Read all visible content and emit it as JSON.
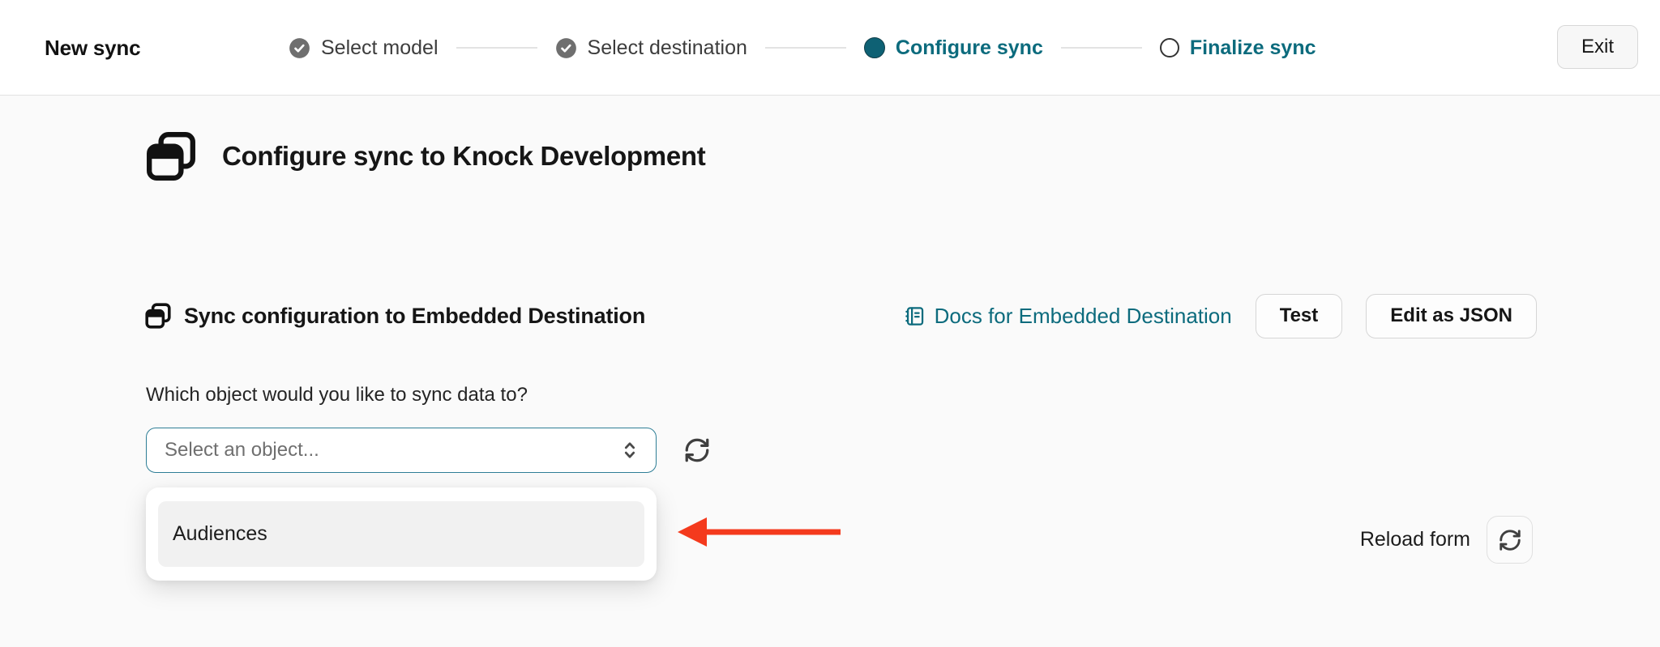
{
  "header": {
    "title": "New sync",
    "steps": [
      {
        "label": "Select model",
        "state": "complete"
      },
      {
        "label": "Select destination",
        "state": "complete"
      },
      {
        "label": "Configure sync",
        "state": "current"
      },
      {
        "label": "Finalize sync",
        "state": "upcoming"
      }
    ],
    "exit_label": "Exit"
  },
  "main": {
    "page_heading": "Configure sync to Knock Development",
    "section": {
      "heading": "Sync configuration to Embedded Destination",
      "docs_link_label": "Docs for Embedded Destination",
      "test_button_label": "Test",
      "edit_json_button_label": "Edit as JSON"
    },
    "form": {
      "question": "Which object would you like to sync data to?",
      "select_placeholder": "Select an object...",
      "dropdown_options": [
        "Audiences"
      ],
      "reload_label": "Reload form"
    }
  },
  "colors": {
    "accent_teal": "#0c6b7d",
    "select_border": "#2e7e96",
    "arrow_red": "#f43a1d",
    "step_complete_gray": "#6f6f6f"
  }
}
